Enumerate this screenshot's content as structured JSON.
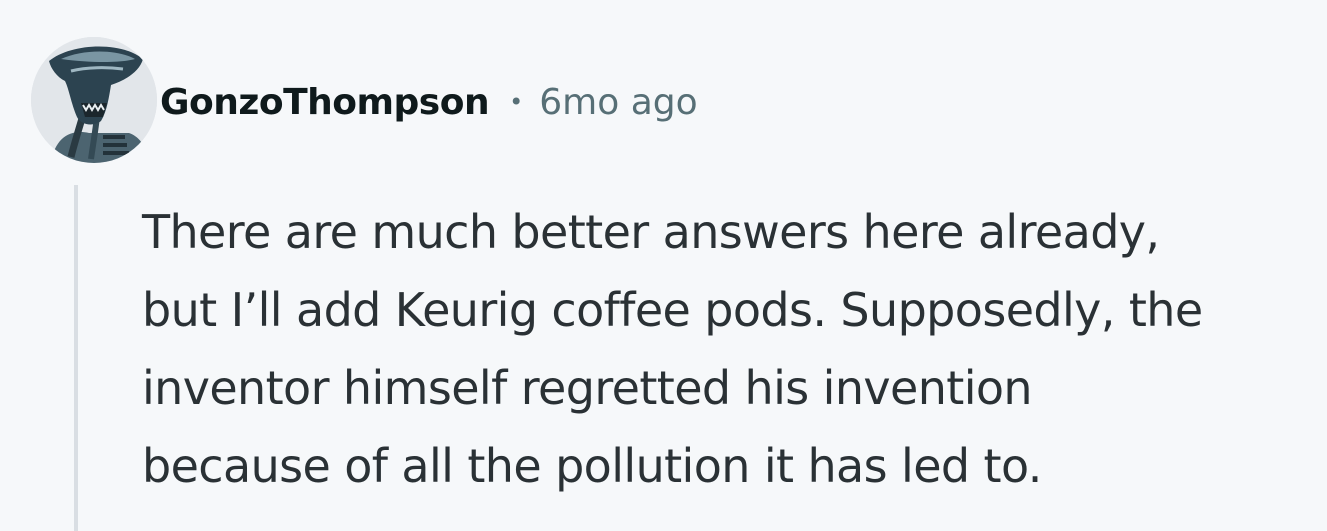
{
  "comment": {
    "author": "GonzoThompson",
    "separator": "•",
    "timestamp": "6mo ago",
    "avatar_icon": "alien-xenomorph-avatar-icon",
    "body_lines": [
      "There are much better answers here already,",
      "but I’ll add Keurig coffee pods. Supposedly, the",
      "inventor himself regretted his invention",
      "because of all the pollution it has led to."
    ]
  },
  "colors": {
    "background": "#f6f8fa",
    "author": "#0f1a1c",
    "meta": "#576f76",
    "body": "#2a3135",
    "thread_line": "#d9dee3"
  }
}
